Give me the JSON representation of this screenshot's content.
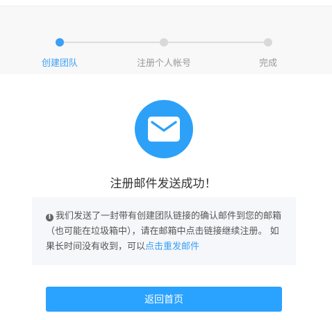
{
  "steps": [
    {
      "label": "创建团队",
      "state": "active"
    },
    {
      "label": "注册个人帐号",
      "state": "pending"
    },
    {
      "label": "完成",
      "state": "pending"
    }
  ],
  "icon": "envelope-icon",
  "title": "注册邮件发送成功！",
  "notice": {
    "info_icon": "info-icon",
    "info_glyph": "i",
    "text": "我们发送了一封带有创建团队链接的确认邮件到您的邮箱（也可能在垃圾箱中），请在邮箱中点击链接继续注册。 如果长时间没有收到，可以",
    "link_text": "点击重发邮件"
  },
  "home_button_label": "返回首页",
  "colors": {
    "accent": "#2da1f8",
    "step_active": "#3a9ff5",
    "step_inactive": "#d9d9d9",
    "step_label_inactive": "#999999",
    "button": "#2aa2ff"
  }
}
